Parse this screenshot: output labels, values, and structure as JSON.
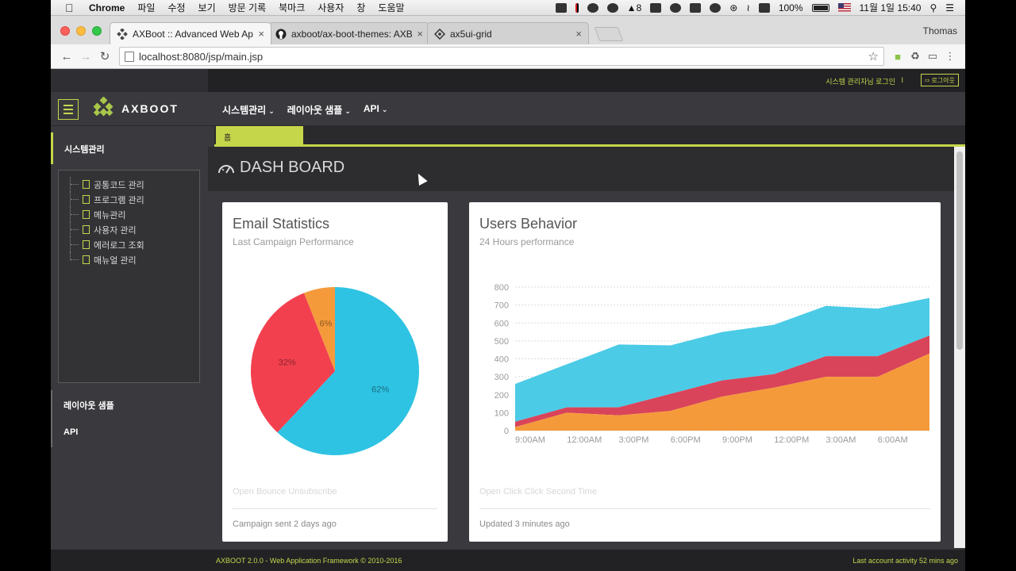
{
  "macos": {
    "app_name": "Chrome",
    "menu": [
      "파일",
      "수정",
      "보기",
      "방문 기록",
      "북마크",
      "사용자",
      "창",
      "도움말"
    ],
    "status": {
      "adobe_count": "8",
      "battery": "100%",
      "datetime": "11월 1일  15:40"
    }
  },
  "browser": {
    "tabs": [
      {
        "title": "AXBoot :: Advanced Web Appl",
        "close": "×"
      },
      {
        "title": "axboot/ax-boot-themes: AXBo",
        "close": "×"
      },
      {
        "title": "ax5ui-grid",
        "close": "×"
      }
    ],
    "profile": "Thomas",
    "url": "localhost:8080/jsp/main.jsp",
    "back": "←",
    "forward": "→",
    "reload": "↻",
    "star": "☆",
    "menu": "⋮"
  },
  "app": {
    "login_text": "시스템 관리자님 로그인",
    "separator": "I",
    "logout_label": "로그아웃",
    "logo_text": "AXBOOT",
    "topnav": [
      "시스템관리",
      "레이아웃 샘플",
      "API"
    ],
    "sidebar": {
      "section": "시스템관리",
      "tree": [
        "공통코드 관리",
        "프로그램 관리",
        "메뉴관리",
        "사용자 관리",
        "에러로그 조회",
        "매뉴얼 관리"
      ],
      "groups": [
        "레이아웃 샘플",
        "API"
      ]
    },
    "home_tab": "홈",
    "page_title": "DASH BOARD",
    "footer_left": "AXBOOT 2.0.0 - Web Application Framework © 2010-2016",
    "footer_right": "Last account activity 52 mins ago"
  },
  "email_card": {
    "title": "Email Statistics",
    "subtitle": "Last Campaign Performance",
    "legend": "Open Bounce Unsubscribe",
    "footer": "Campaign sent 2 days ago"
  },
  "users_card": {
    "title": "Users Behavior",
    "subtitle": "24 Hours performance",
    "legend": "Open Click Click Second Time",
    "footer": "Updated 3 minutes ago"
  },
  "chart_data": [
    {
      "type": "pie",
      "categories": [
        "Open",
        "Bounce",
        "Unsubscribe"
      ],
      "values": [
        62,
        32,
        6
      ],
      "labels": [
        "62%",
        "32%",
        "6%"
      ],
      "colors": [
        "#2ec3e3",
        "#f2404f",
        "#f59a3b"
      ]
    },
    {
      "type": "area",
      "stacked": true,
      "x_ticks": [
        "9:00AM",
        "12:00AM",
        "3:00PM",
        "6:00PM",
        "9:00PM",
        "12:00PM",
        "3:00AM",
        "6:00AM"
      ],
      "y_ticks": [
        "800",
        "700",
        "600",
        "500",
        "400",
        "300",
        "200",
        "100",
        "0"
      ],
      "ylim": [
        0,
        800
      ],
      "x": [
        0,
        1,
        2,
        3,
        4,
        5,
        6,
        7,
        8
      ],
      "series": [
        {
          "color": "#f59a3b",
          "values": [
            20,
            100,
            85,
            110,
            190,
            240,
            300,
            300,
            430
          ]
        },
        {
          "color": "#d9445a",
          "values": [
            30,
            30,
            45,
            95,
            90,
            75,
            115,
            115,
            100
          ]
        },
        {
          "color": "#4bcbe6",
          "values": [
            210,
            240,
            350,
            270,
            270,
            275,
            280,
            265,
            210
          ]
        }
      ]
    }
  ]
}
